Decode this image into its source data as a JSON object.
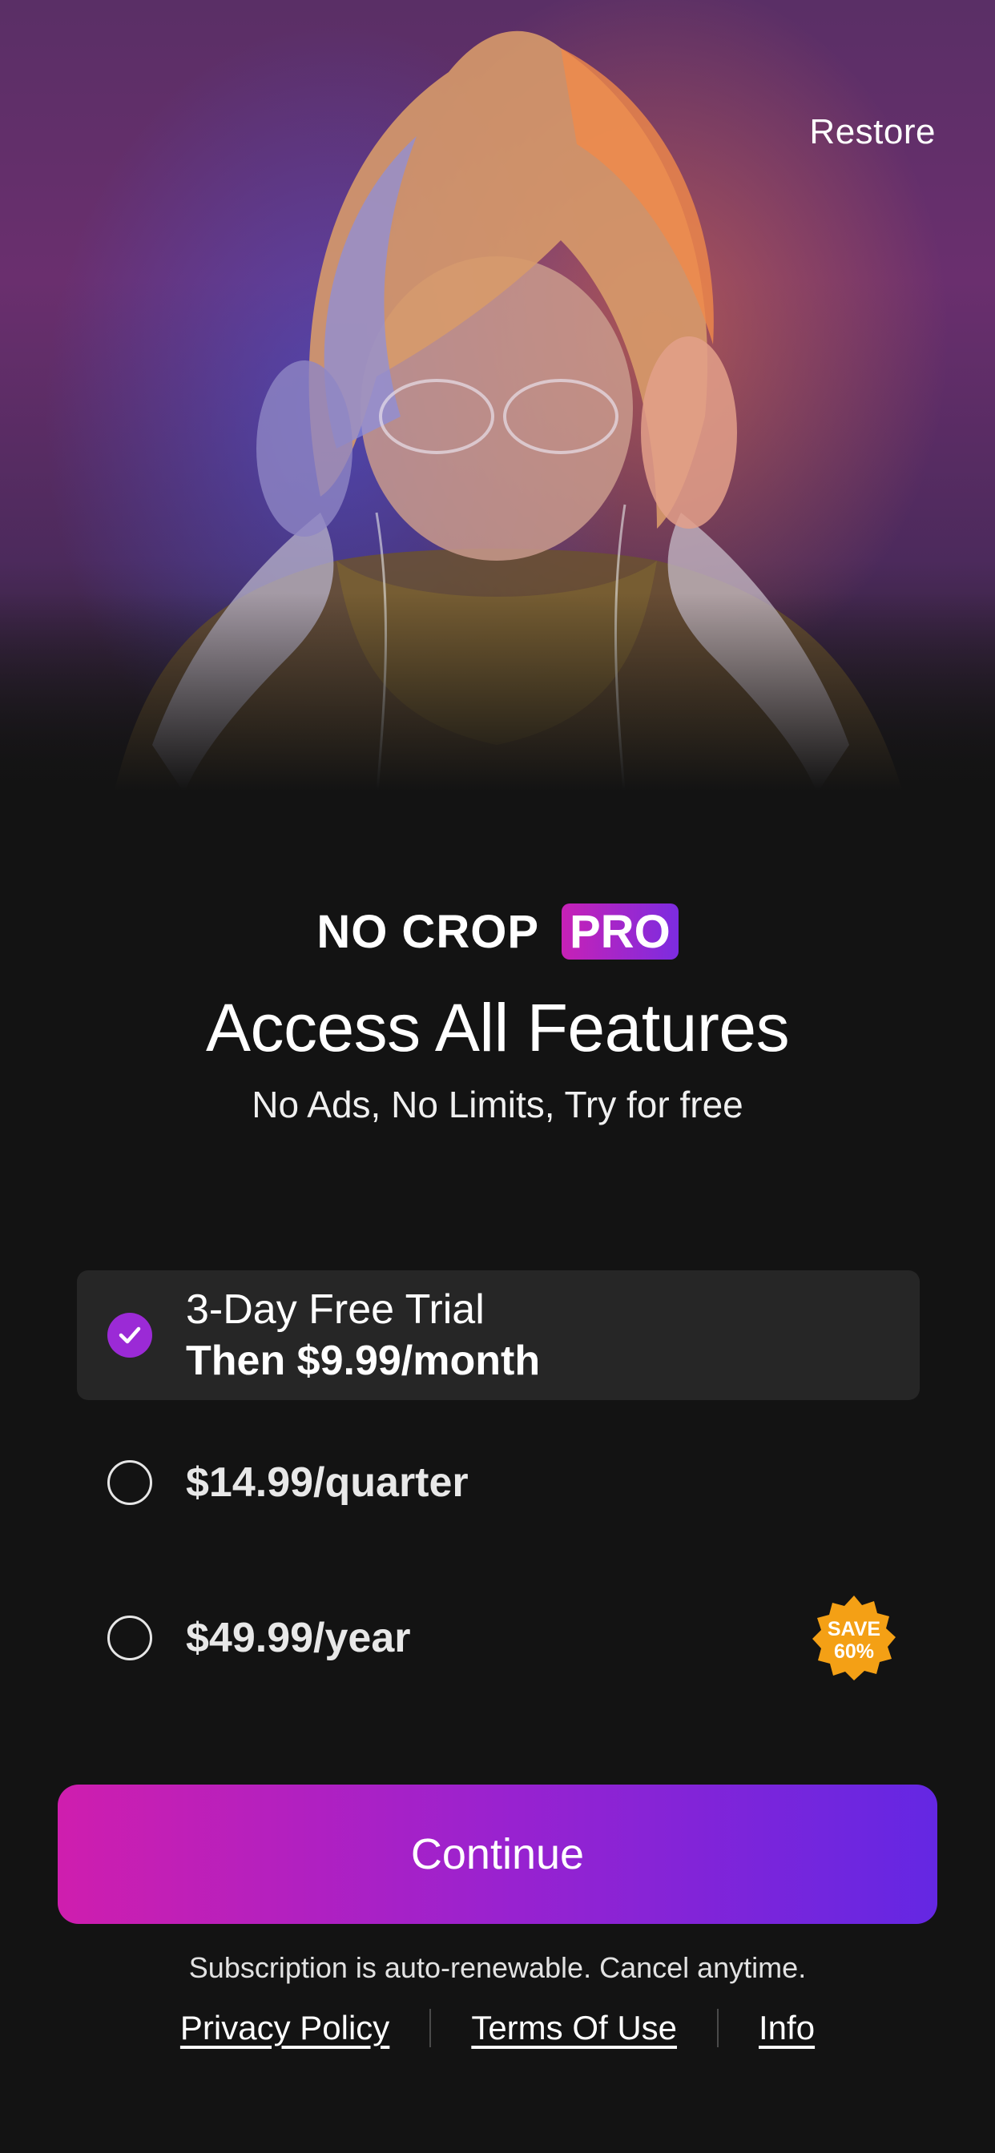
{
  "header": {
    "restore_label": "Restore"
  },
  "brand": {
    "name": "NO CROP",
    "badge": "PRO"
  },
  "headline": "Access All Features",
  "subheadline": "No Ads, No Limits, Try for free",
  "plans": [
    {
      "line1": "3-Day Free Trial",
      "line2": "Then $9.99/month",
      "selected": true
    },
    {
      "price": "$14.99/quarter",
      "selected": false
    },
    {
      "price": "$49.99/year",
      "selected": false,
      "badge_line1": "SAVE",
      "badge_line2": "60%"
    }
  ],
  "cta": {
    "continue_label": "Continue"
  },
  "disclaimer": "Subscription is auto-renewable. Cancel anytime.",
  "footer": {
    "privacy_label": "Privacy Policy",
    "terms_label": "Terms Of Use ",
    "info_label": "Info"
  },
  "colors": {
    "background": "#131313",
    "accent_start": "#cf1eae",
    "accent_end": "#6427e3",
    "radio_selected": "#9b2ad6",
    "save_badge": "#f4a015",
    "selected_card": "#262626"
  },
  "icons": {
    "selected_radio": "checkmark-icon",
    "save_badge": "starburst-badge-icon"
  }
}
